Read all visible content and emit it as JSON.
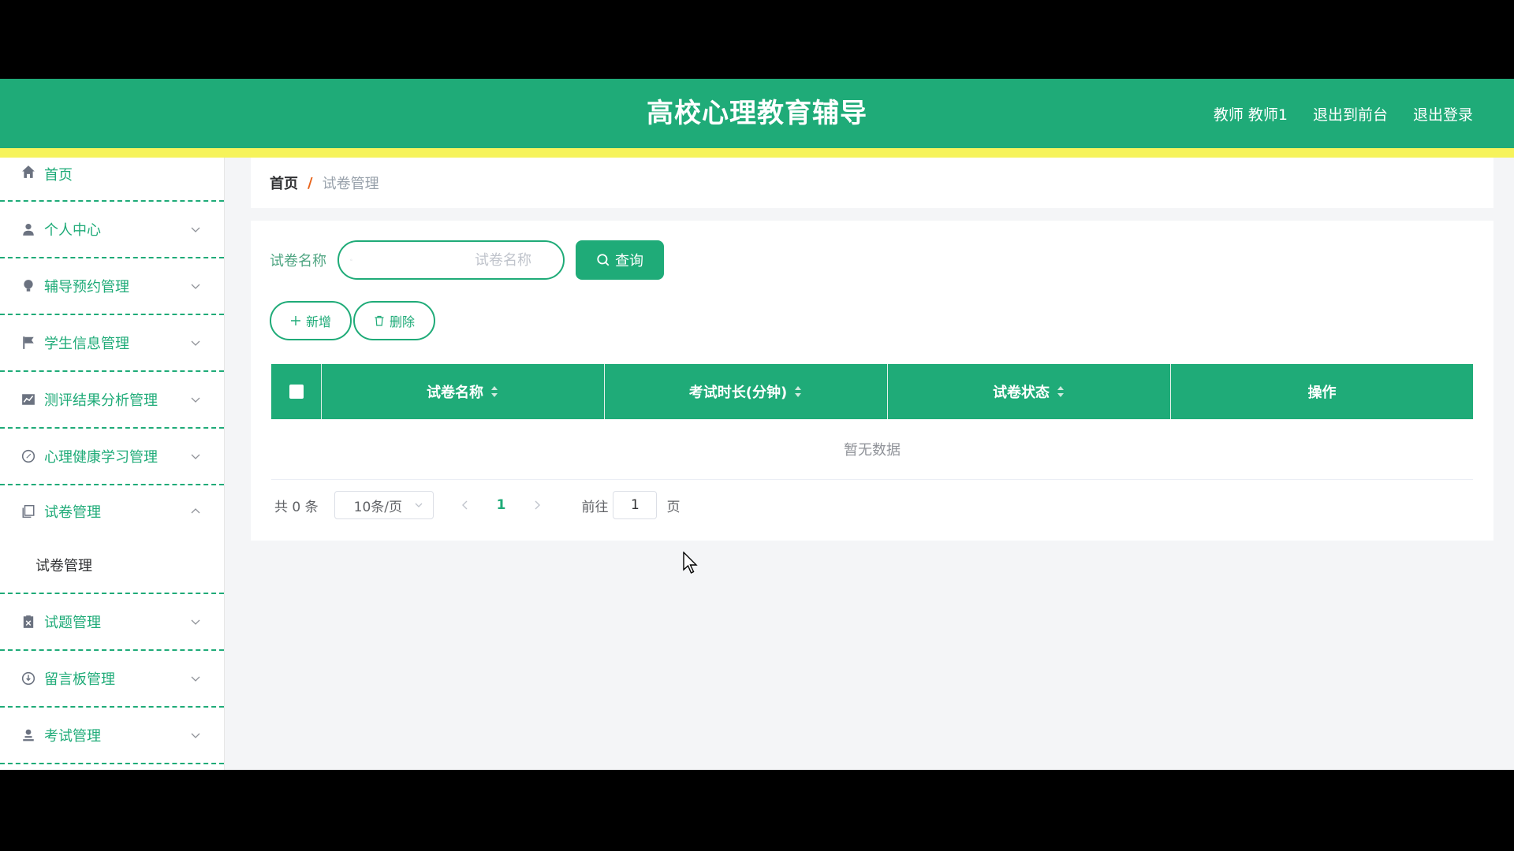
{
  "header": {
    "title": "高校心理教育辅导",
    "user": "教师 教师1",
    "to_front": "退出到前台",
    "logout": "退出登录",
    "bg_color": "#1fab78",
    "stripe_color": "#f6f35b"
  },
  "sidebar": {
    "items": [
      {
        "label": "首页",
        "icon": "home-icon"
      },
      {
        "label": "个人中心",
        "icon": "user-icon"
      },
      {
        "label": "辅导预约管理",
        "icon": "lightbulb-icon"
      },
      {
        "label": "学生信息管理",
        "icon": "flag-icon"
      },
      {
        "label": "测评结果分析管理",
        "icon": "chart-icon"
      },
      {
        "label": "心理健康学习管理",
        "icon": "compass-icon"
      },
      {
        "label": "试卷管理",
        "icon": "document-icon"
      },
      {
        "label": "试题管理",
        "icon": "clipboard-icon"
      },
      {
        "label": "留言板管理",
        "icon": "message-icon"
      },
      {
        "label": "考试管理",
        "icon": "person-icon"
      }
    ],
    "submenu": {
      "label": "试卷管理"
    }
  },
  "breadcrumb": {
    "home": "首页",
    "separator": "/",
    "current": "试卷管理"
  },
  "search": {
    "label": "试卷名称",
    "placeholder": "试卷名称",
    "query_button": "查询"
  },
  "actions": {
    "add": "新增",
    "delete": "删除"
  },
  "table": {
    "columns": [
      "试卷名称",
      "考试时长(分钟)",
      "试卷状态",
      "操作"
    ],
    "empty_text": "暂无数据"
  },
  "pagination": {
    "total": "共 0 条",
    "page_size": "10条/页",
    "current_page": "1",
    "goto_label": "前往",
    "goto_value": "1",
    "goto_suffix": "页"
  }
}
